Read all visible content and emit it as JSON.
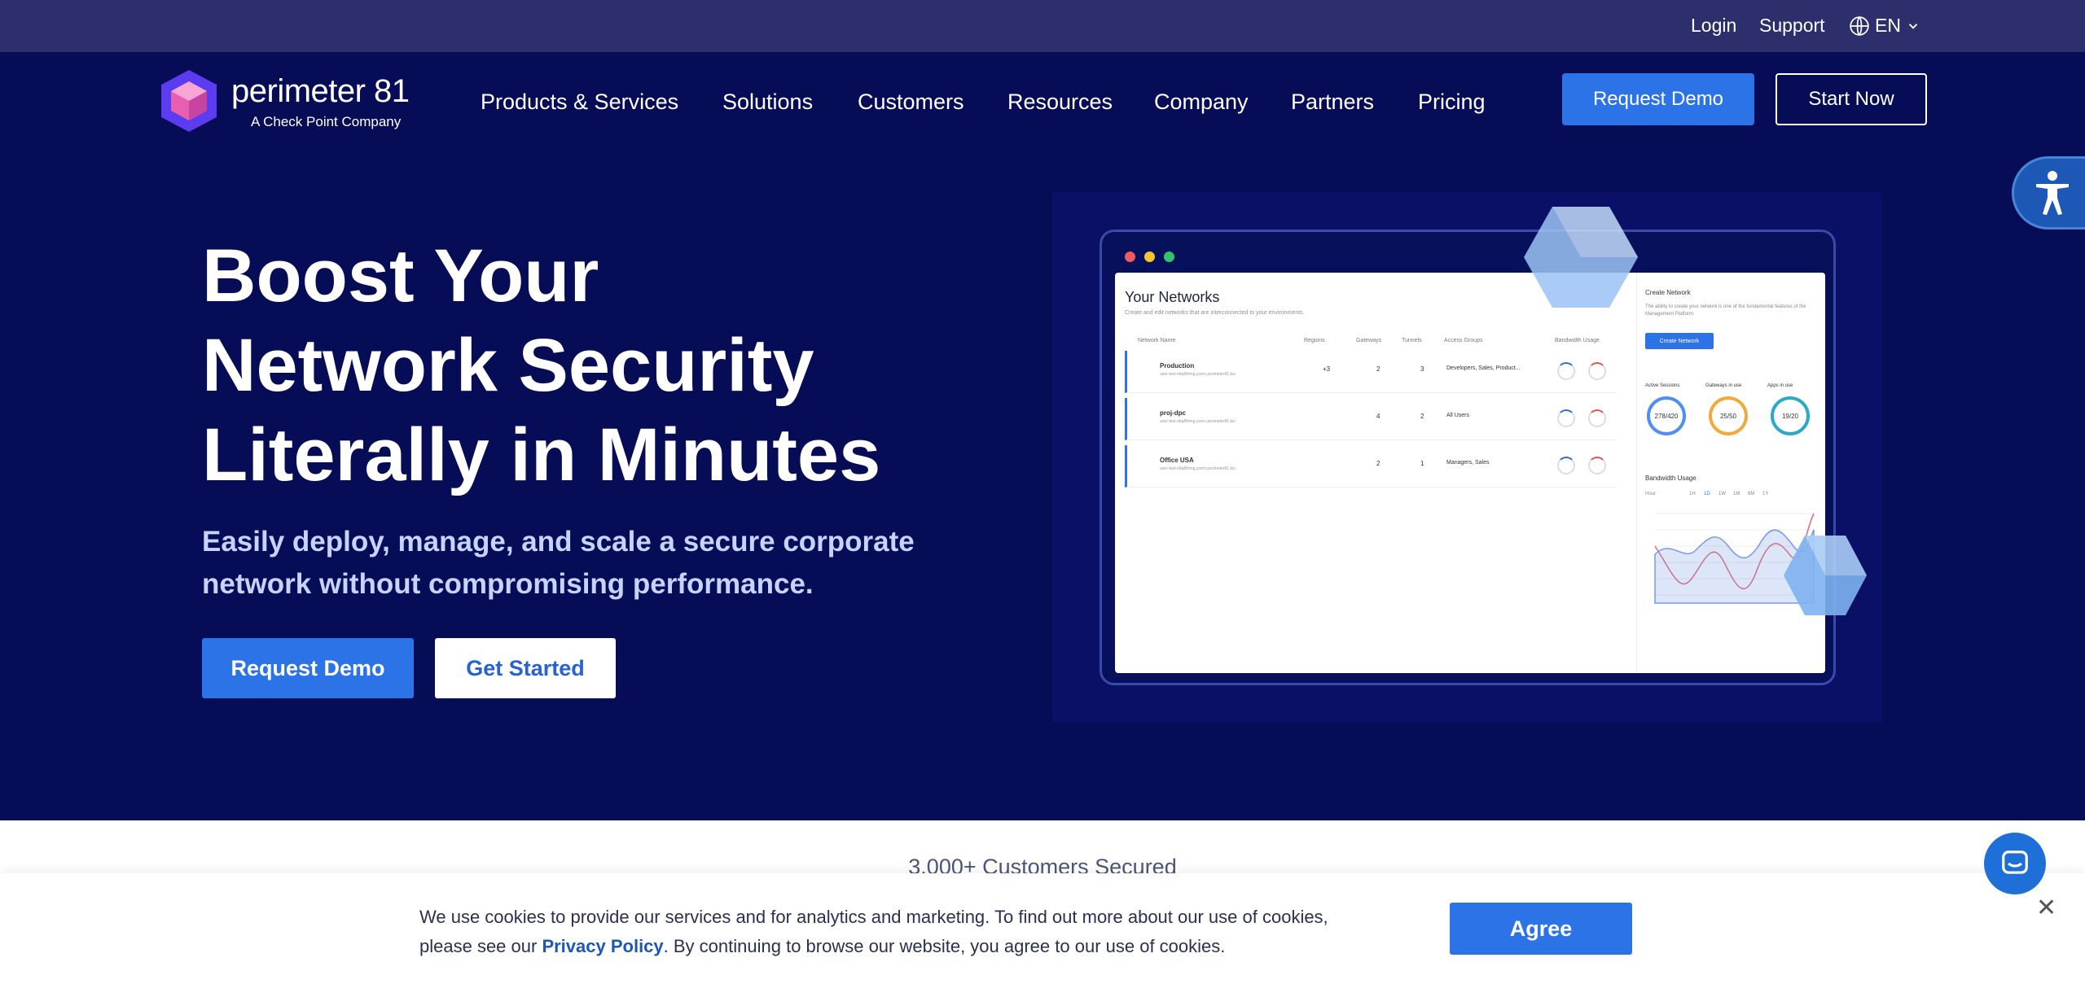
{
  "topbar": {
    "login": "Login",
    "support": "Support",
    "language": "EN"
  },
  "header": {
    "logo_name": "perimeter 81",
    "logo_tagline": "A Check Point Company",
    "nav": [
      "Products & Services",
      "Solutions",
      "Customers",
      "Resources",
      "Company",
      "Partners",
      "Pricing"
    ],
    "request_demo": "Request Demo",
    "start_now": "Start Now"
  },
  "hero": {
    "title_lines": [
      "Boost Your",
      "Network Security",
      "Literally in Minutes"
    ],
    "subtitle": "Easily deploy, manage, and scale a secure corporate network without compromising performance.",
    "primary_cta": "Request Demo",
    "secondary_cta": "Get Started"
  },
  "mockup": {
    "title": "Your Networks",
    "description": "Create and edit networks that are interconnected to your environments.",
    "columns": [
      "Network Name",
      "Regions",
      "Gateways",
      "Tunnels",
      "Access Groups",
      "Bandwidth Usage"
    ],
    "rows": [
      {
        "name": "Production",
        "sub": "user-test-nbq8fnmg.yzero.perimeter81.biz",
        "regions": "+3",
        "gateways": "2",
        "tunnels": "3",
        "groups": "Developers, Sales, Product...",
        "bw1": "55%",
        "bw2": "87%"
      },
      {
        "name": "proj-dpc",
        "sub": "user-test-nbq8fnmg.yzero.perimeter81.biz",
        "regions": "",
        "gateways": "4",
        "tunnels": "2",
        "groups": "All Users",
        "bw1": "32%",
        "bw2": "76%"
      },
      {
        "name": "Office USA",
        "sub": "user-test-nbq8fnmg.yzero.perimeter81.biz",
        "regions": "",
        "gateways": "2",
        "tunnels": "1",
        "groups": "Managers, Sales",
        "bw1": "55%",
        "bw2": "21%"
      }
    ],
    "side": {
      "create_title": "Create Network",
      "create_desc": "The ability to create your network is one of the fundamental features of the Management Platform.",
      "create_btn": "Create Network",
      "stats": [
        {
          "label": "Active Sessions",
          "value": "278/420"
        },
        {
          "label": "Gateways in use",
          "value": "25/50"
        },
        {
          "label": "Apps in use",
          "value": "19/20"
        }
      ],
      "bandwidth_title": "Bandwidth Usage",
      "range_select": "Hour",
      "ranges": [
        "1H",
        "1D",
        "1W",
        "1M",
        "6M",
        "1Y"
      ]
    }
  },
  "customers_secured": "3,000+ Customers Secured",
  "cookie": {
    "text_before": "We use cookies to provide our services and for analytics and marketing. To find out more about our use of cookies, please see our ",
    "link": "Privacy Policy",
    "text_after": ". By continuing to browse our website, you agree to our use of cookies.",
    "agree": "Agree"
  },
  "colors": {
    "hero_bg": "#060d56",
    "topbar_bg": "#2d2f6d",
    "accent": "#2b73e6"
  }
}
